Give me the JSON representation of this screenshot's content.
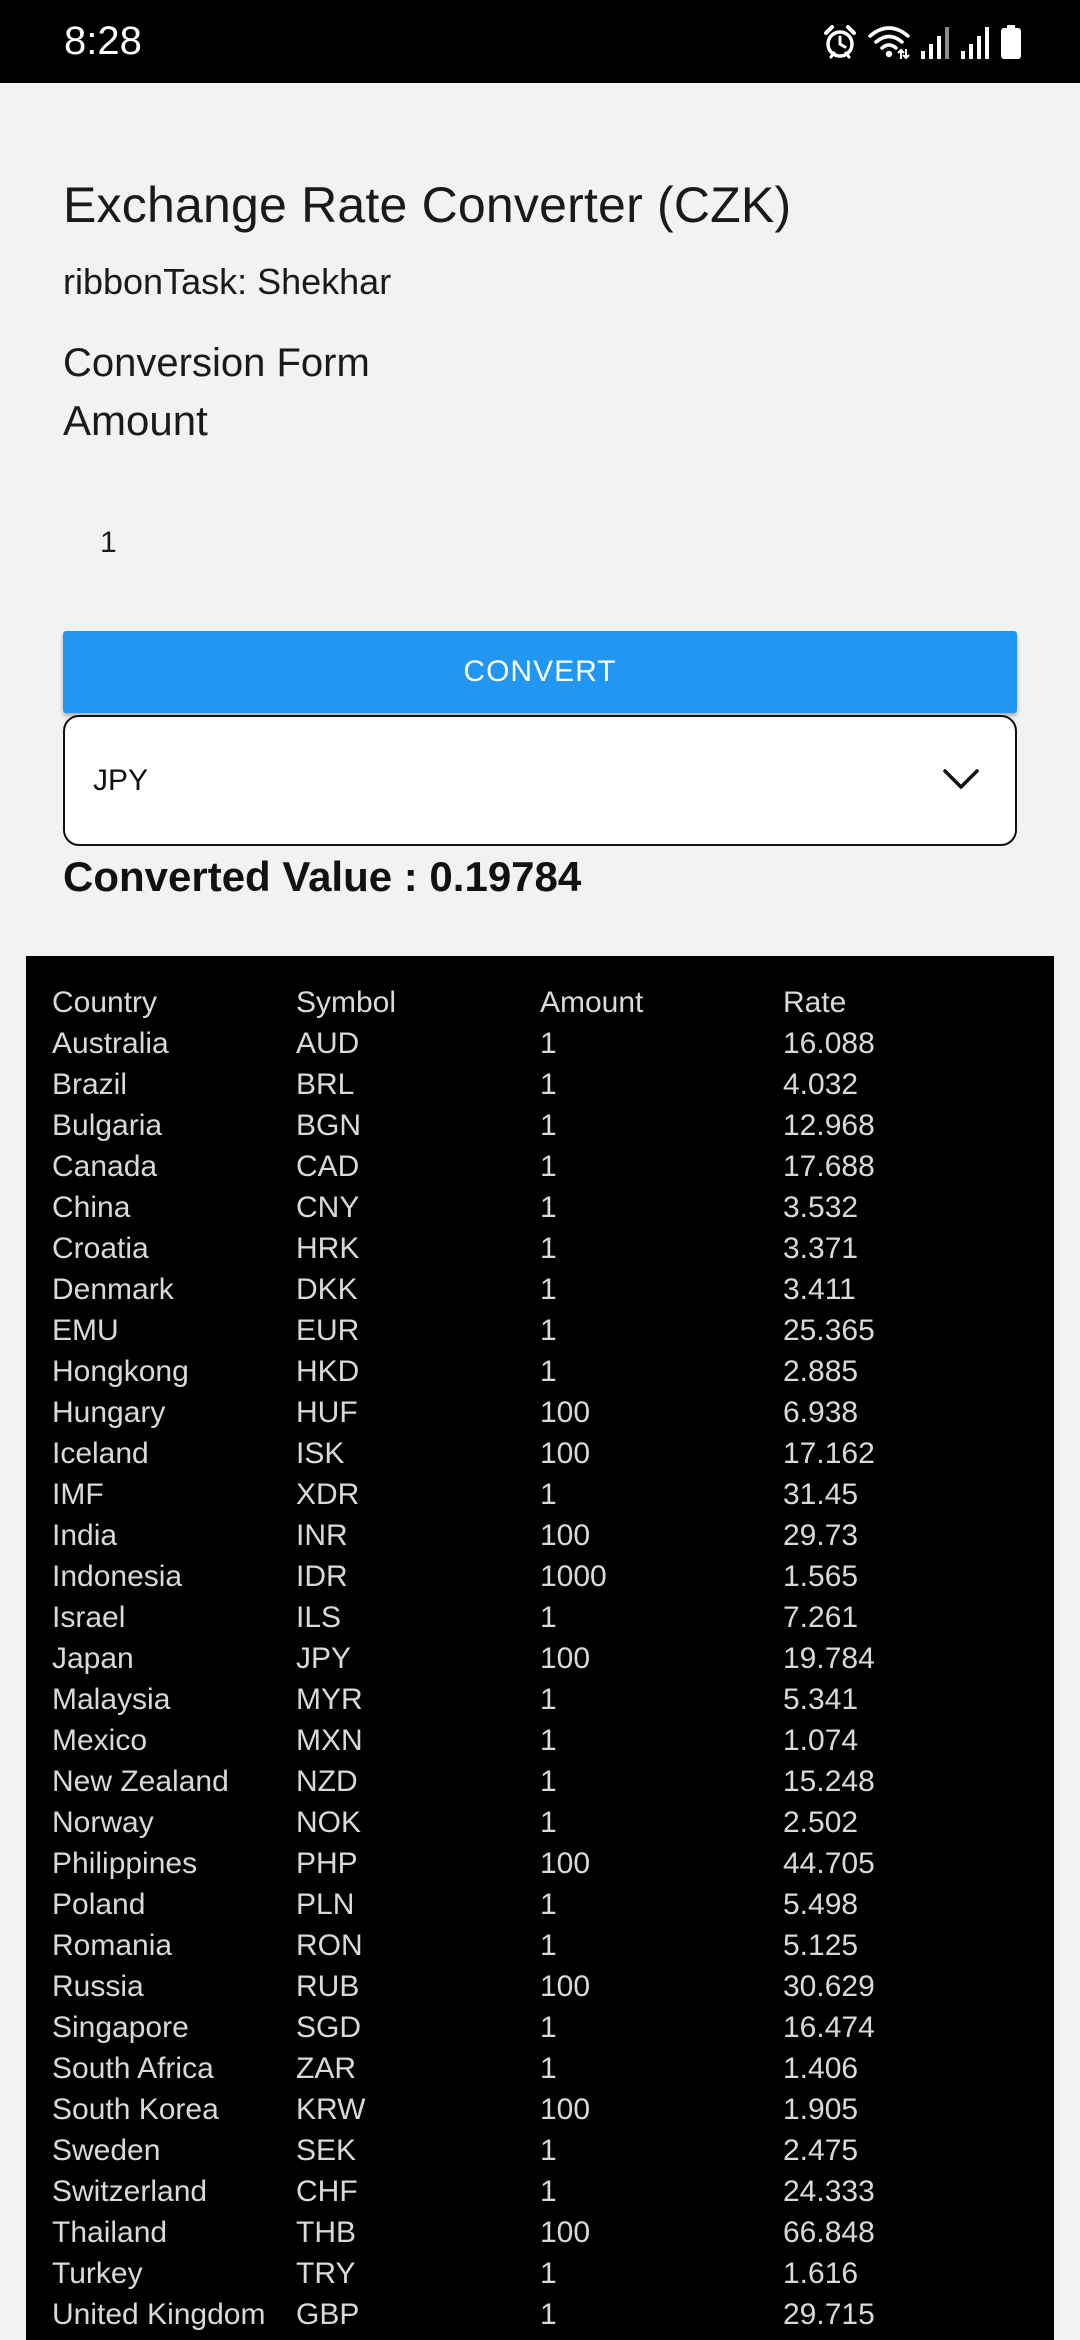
{
  "status_bar": {
    "time": "8:28"
  },
  "app": {
    "title": "Exchange Rate Converter (CZK)",
    "subtitle": "ribbonTask: Shekhar"
  },
  "form": {
    "heading": "Conversion Form",
    "amount_label": "Amount",
    "amount_value": "1",
    "convert_label": "CONVERT",
    "selected_currency": "JPY",
    "converted_value_text": "Converted Value : 0.19784"
  },
  "colors": {
    "accent": "#2196f3",
    "table_background": "#000000",
    "page_background": "#f2f2f2"
  },
  "table": {
    "headers": [
      "Country",
      "Symbol",
      "Amount",
      "Rate"
    ],
    "rows": [
      [
        "Australia",
        "AUD",
        "1",
        "16.088"
      ],
      [
        "Brazil",
        "BRL",
        "1",
        "4.032"
      ],
      [
        "Bulgaria",
        "BGN",
        "1",
        "12.968"
      ],
      [
        "Canada",
        "CAD",
        "1",
        "17.688"
      ],
      [
        "China",
        "CNY",
        "1",
        "3.532"
      ],
      [
        "Croatia",
        "HRK",
        "1",
        "3.371"
      ],
      [
        "Denmark",
        "DKK",
        "1",
        "3.411"
      ],
      [
        "EMU",
        "EUR",
        "1",
        "25.365"
      ],
      [
        "Hongkong",
        "HKD",
        "1",
        "2.885"
      ],
      [
        "Hungary",
        "HUF",
        "100",
        "6.938"
      ],
      [
        "Iceland",
        "ISK",
        "100",
        "17.162"
      ],
      [
        "IMF",
        "XDR",
        "1",
        "31.45"
      ],
      [
        "India",
        "INR",
        "100",
        "29.73"
      ],
      [
        "Indonesia",
        "IDR",
        "1000",
        "1.565"
      ],
      [
        "Israel",
        "ILS",
        "1",
        "7.261"
      ],
      [
        "Japan",
        "JPY",
        "100",
        "19.784"
      ],
      [
        "Malaysia",
        "MYR",
        "1",
        "5.341"
      ],
      [
        "Mexico",
        "MXN",
        "1",
        "1.074"
      ],
      [
        "New Zealand",
        "NZD",
        "1",
        "15.248"
      ],
      [
        "Norway",
        "NOK",
        "1",
        "2.502"
      ],
      [
        "Philippines",
        "PHP",
        "100",
        "44.705"
      ],
      [
        "Poland",
        "PLN",
        "1",
        "5.498"
      ],
      [
        "Romania",
        "RON",
        "1",
        "5.125"
      ],
      [
        "Russia",
        "RUB",
        "100",
        "30.629"
      ],
      [
        "Singapore",
        "SGD",
        "1",
        "16.474"
      ],
      [
        "South Africa",
        "ZAR",
        "1",
        "1.406"
      ],
      [
        "South Korea",
        "KRW",
        "100",
        "1.905"
      ],
      [
        "Sweden",
        "SEK",
        "1",
        "2.475"
      ],
      [
        "Switzerland",
        "CHF",
        "1",
        "24.333"
      ],
      [
        "Thailand",
        "THB",
        "100",
        "66.848"
      ],
      [
        "Turkey",
        "TRY",
        "1",
        "1.616"
      ],
      [
        "United Kingdom",
        "GBP",
        "1",
        "29.715"
      ]
    ]
  },
  "icons": {
    "alarm": "alarm-icon",
    "wifi": "wifi-icon",
    "signal1": "signal-icon",
    "signal2": "signal-icon",
    "battery": "battery-icon",
    "chevron": "chevron-down-icon"
  }
}
